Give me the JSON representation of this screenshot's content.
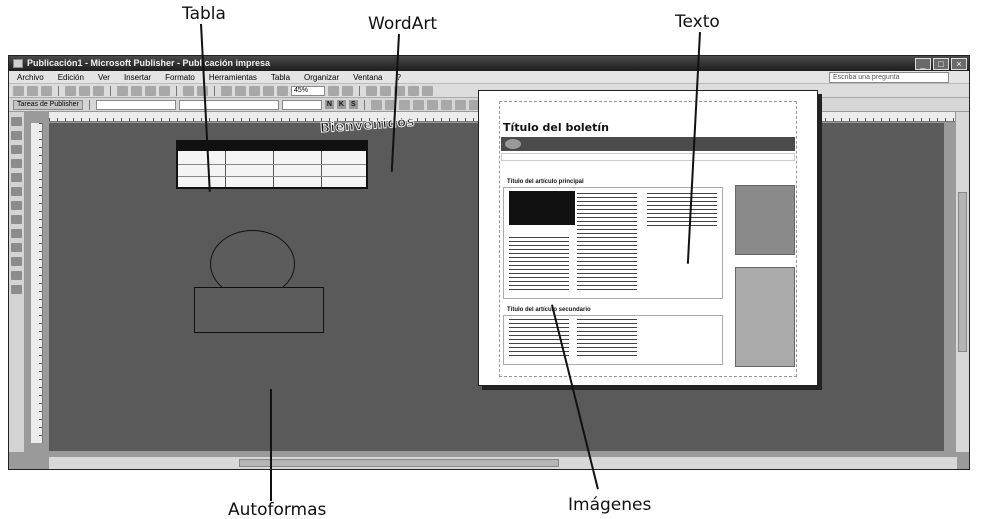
{
  "callouts": {
    "tabla": "Tabla",
    "wordart": "WordArt",
    "texto": "Texto",
    "autoformas": "Autoformas",
    "imagenes": "Imágenes"
  },
  "window": {
    "title": "Publicación1 - Microsoft Publisher - Publicación impresa",
    "menu": [
      "Archivo",
      "Edición",
      "Ver",
      "Insertar",
      "Formato",
      "Herramientas",
      "Tabla",
      "Organizar",
      "Ventana",
      "?"
    ],
    "ask_placeholder": "Escriba una pregunta",
    "zoom": "45%",
    "task_pane_button": "Tareas de Publisher"
  },
  "canvas": {
    "wordart_text": "Bienvenidos"
  },
  "newsletter": {
    "title": "Título del boletín",
    "section1": "Título del artículo principal",
    "section2": "Título del artículo secundario"
  },
  "colors": {
    "canvas": "#5a5a5a",
    "titlebar": "#1e1e1e"
  }
}
